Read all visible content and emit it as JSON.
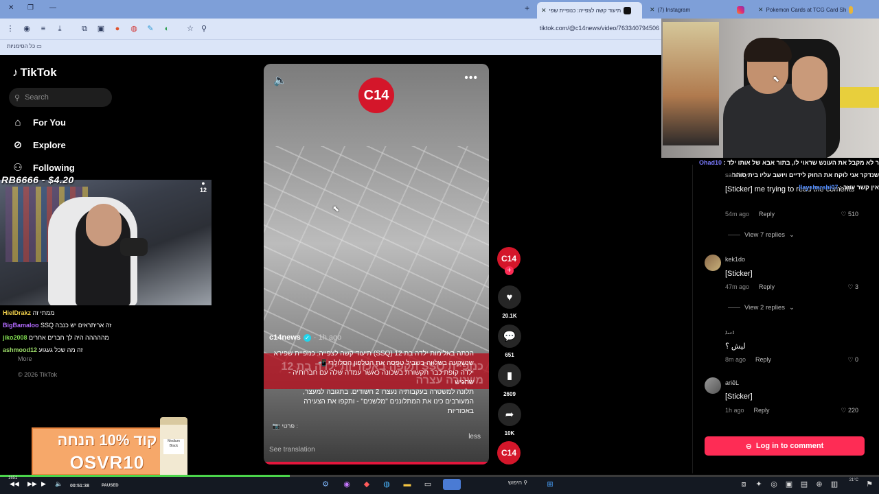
{
  "browser": {
    "tabs": [
      {
        "label": "Pokemon Cards at TCG Card Sh",
        "active": false
      },
      {
        "label": "(7) Instagram",
        "active": false
      },
      {
        "label": "תיעוד קשה לצפייה: כנופיית שפי",
        "active": true
      }
    ],
    "address": "tiktok.com/@c14news/video/763340794506",
    "bookmarks_label": "כל הסימניות"
  },
  "sidebar": {
    "logo": "TikTok",
    "search_placeholder": "Search",
    "nav": [
      {
        "label": "For You",
        "icon": "home-icon"
      },
      {
        "label": "Explore",
        "icon": "compass-icon"
      },
      {
        "label": "Following",
        "icon": "people-icon"
      }
    ],
    "more": "More",
    "copyright": "© 2026 TikTok"
  },
  "stream": {
    "donation": "RB6666 - $4.20",
    "badge": "12",
    "chat_left": [
      {
        "user": "HielDrakz",
        "text": "ממתי זה",
        "color": "#f2d14b"
      },
      {
        "user": "BigBamaloo",
        "text": "SSQ זה אריתראים יש כנבה",
        "color": "#b36bff"
      },
      {
        "user": "jiko2008",
        "text": "מההההה היה לך חברים אחרים",
        "color": "#7fd94f"
      },
      {
        "user": "ashmood12",
        "text": "זה מה שכל געגוע",
        "color": "#9fe06b"
      }
    ],
    "chat_right": [
      {
        "user": "Ohad10",
        "text": "ר לא מקבל את העונש שראוי לו, בתור אבא של אותו ילד",
        "color": "#7b7bff"
      },
      {
        "user": "",
        "text": "שנדקר אני לוקח את החוק לידיים ויושב עליו בית סוהר",
        "color": "#ffffff"
      },
      {
        "user": "llaysharabi07",
        "text": "אין קשר עוזר",
        "color": "#4f8bff"
      }
    ],
    "promo_top": "קוד 10% הנחה",
    "promo_code": "OSVR10",
    "bottle_label": "Medium Black"
  },
  "video": {
    "logo": "C14",
    "author": "c14news",
    "time": "1h ago",
    "burned_text": "כנופיית SSQ תקפה באכזריות ילדה בת 12 משטרה עצרה",
    "caption_lines": [
      "הכתה באלימות ילדה בת 12 (SSQ) תיעוד קשה לצפייה: כנופיית שפירא",
      "שנשקעה בשלווה בשביל טפסה את הטלפון הסלולרי 📲",
      "ילדה קופת כבר תקשורת בשכונה כאשר עמדה שלה עם חברותיה - שהגיש",
      "תלונה למשטרה בעקבותיה נעצרו 2 חשודים. בתגובה למעצר,",
      "המעורבים כינו את המתלוננים \"מלשנים\" - ותקפו את הצעירה",
      "באכזריות"
    ],
    "source": "📷 פרטי :",
    "less": "less",
    "see_translation": "See translation"
  },
  "actions": {
    "avatar": "C14",
    "likes": "20.1K",
    "comments": "651",
    "saves": "2609",
    "shares": "10K",
    "music": "C14"
  },
  "comments": [
    {
      "type": "comment",
      "name": "sab4kky",
      "text": "[Sticker] me trying to read the coments",
      "time": "54m ago",
      "reply": "Reply",
      "likes": "510"
    },
    {
      "type": "replies",
      "label": "View 7 replies"
    },
    {
      "type": "comment",
      "name": "kek1do",
      "text": "[Sticker]",
      "time": "47m ago",
      "reply": "Reply",
      "likes": "3"
    },
    {
      "type": "replies",
      "label": "View 2 replies"
    },
    {
      "type": "comment",
      "name": "ܐܢܝܐ",
      "text": "ليش ؟",
      "time": "8m ago",
      "reply": "Reply",
      "likes": "0"
    },
    {
      "type": "comment",
      "name": "ariēL",
      "text": "[Sticker]",
      "time": "1h ago",
      "reply": "Reply",
      "likes": "220"
    }
  ],
  "login_button": "Log in to comment",
  "player": {
    "time": "00:51:38",
    "status": "PAUSED",
    "progress": 0.33,
    "clock_left": "1651",
    "clock_right_top": "21°C",
    "task_search": "חיפוש"
  },
  "colors": {
    "tiktok_red": "#fe2c55",
    "c14_red": "#d4162a",
    "chrome_blue": "#7e9fd8"
  }
}
